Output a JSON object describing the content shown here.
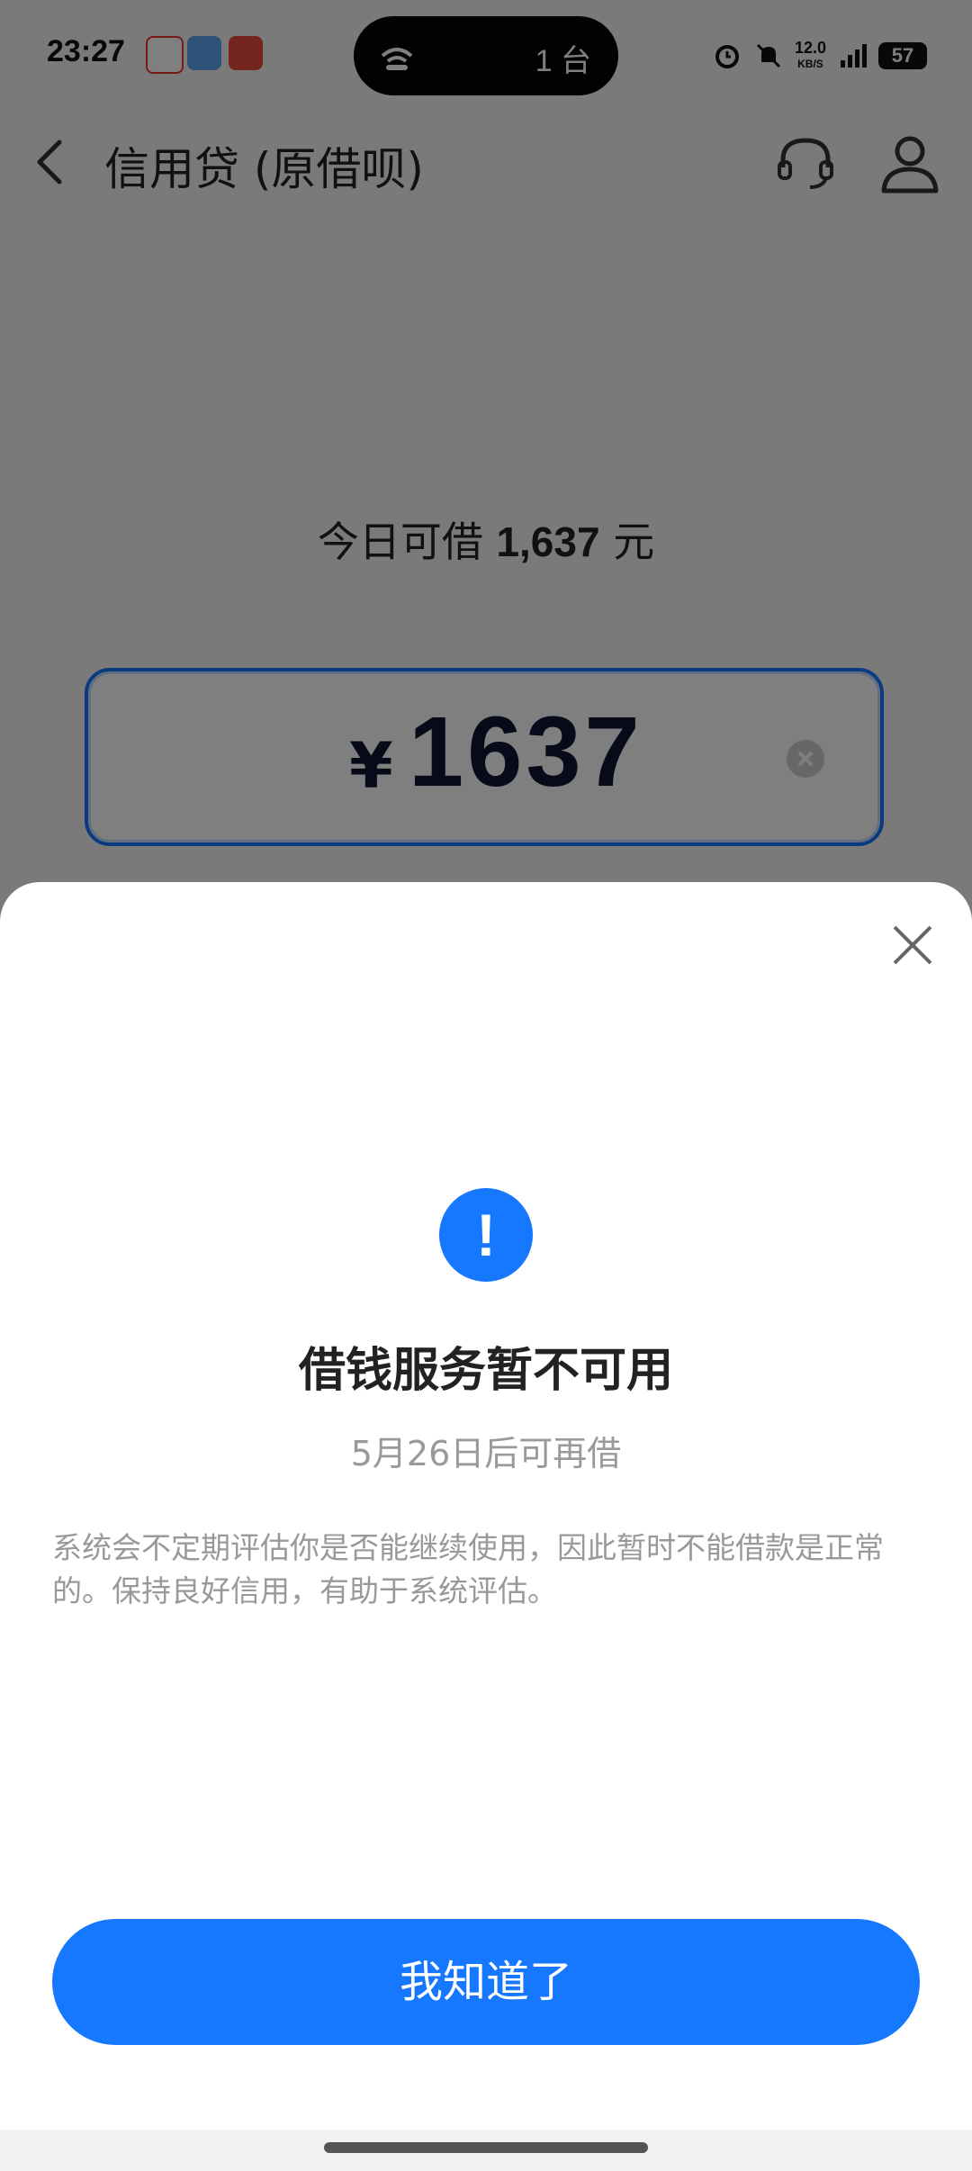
{
  "status_bar": {
    "time": "23:27",
    "island_text": "1 台",
    "net_speed_value": "12.0",
    "net_speed_unit": "KB/S",
    "battery": "57"
  },
  "nav": {
    "title": "信用贷 (原借呗)"
  },
  "loan": {
    "available_prefix": "今日可借",
    "available_amount": "1,637",
    "available_suffix": "元",
    "currency": "¥",
    "amount_value": "1637"
  },
  "dialog": {
    "title": "借钱服务暂不可用",
    "subtitle": "5月26日后可再借",
    "description": "系统会不定期评估你是否能继续使用，因此暂时不能借款是正常的。保持良好信用，有助于系统评估。",
    "confirm_label": "我知道了",
    "alert_glyph": "!"
  },
  "colors": {
    "accent": "#1677ff"
  }
}
